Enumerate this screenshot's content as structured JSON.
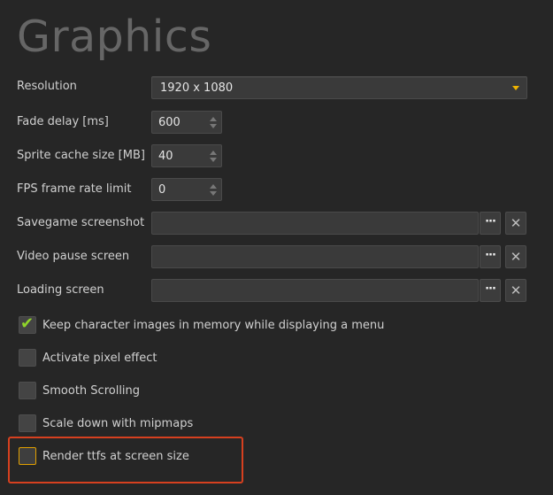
{
  "page": {
    "title": "Graphics"
  },
  "resolution": {
    "label": "Resolution",
    "value": "1920 x 1080"
  },
  "fade_delay": {
    "label": "Fade delay [ms]",
    "value": "600"
  },
  "sprite_cache": {
    "label": "Sprite cache size [MB]",
    "value": "40"
  },
  "fps_limit": {
    "label": "FPS frame rate limit",
    "value": "0"
  },
  "savegame_screenshot": {
    "label": "Savegame screenshot",
    "value": "",
    "browse": "···",
    "clear": "✕"
  },
  "video_pause": {
    "label": "Video pause screen",
    "value": "",
    "browse": "···",
    "clear": "✕"
  },
  "loading_screen": {
    "label": "Loading screen",
    "value": "",
    "browse": "···",
    "clear": "✕"
  },
  "checkboxes": [
    {
      "label": "Keep character images in memory while displaying a menu",
      "checked": true
    },
    {
      "label": "Activate pixel effect",
      "checked": false
    },
    {
      "label": "Smooth Scrolling",
      "checked": false
    },
    {
      "label": "Scale down with mipmaps",
      "checked": false
    },
    {
      "label": "Render ttfs at screen size",
      "checked": false
    }
  ],
  "colors": {
    "accent": "#f0b400",
    "check": "#8fd42a",
    "highlight": "#d6401f",
    "background": "#262626"
  }
}
